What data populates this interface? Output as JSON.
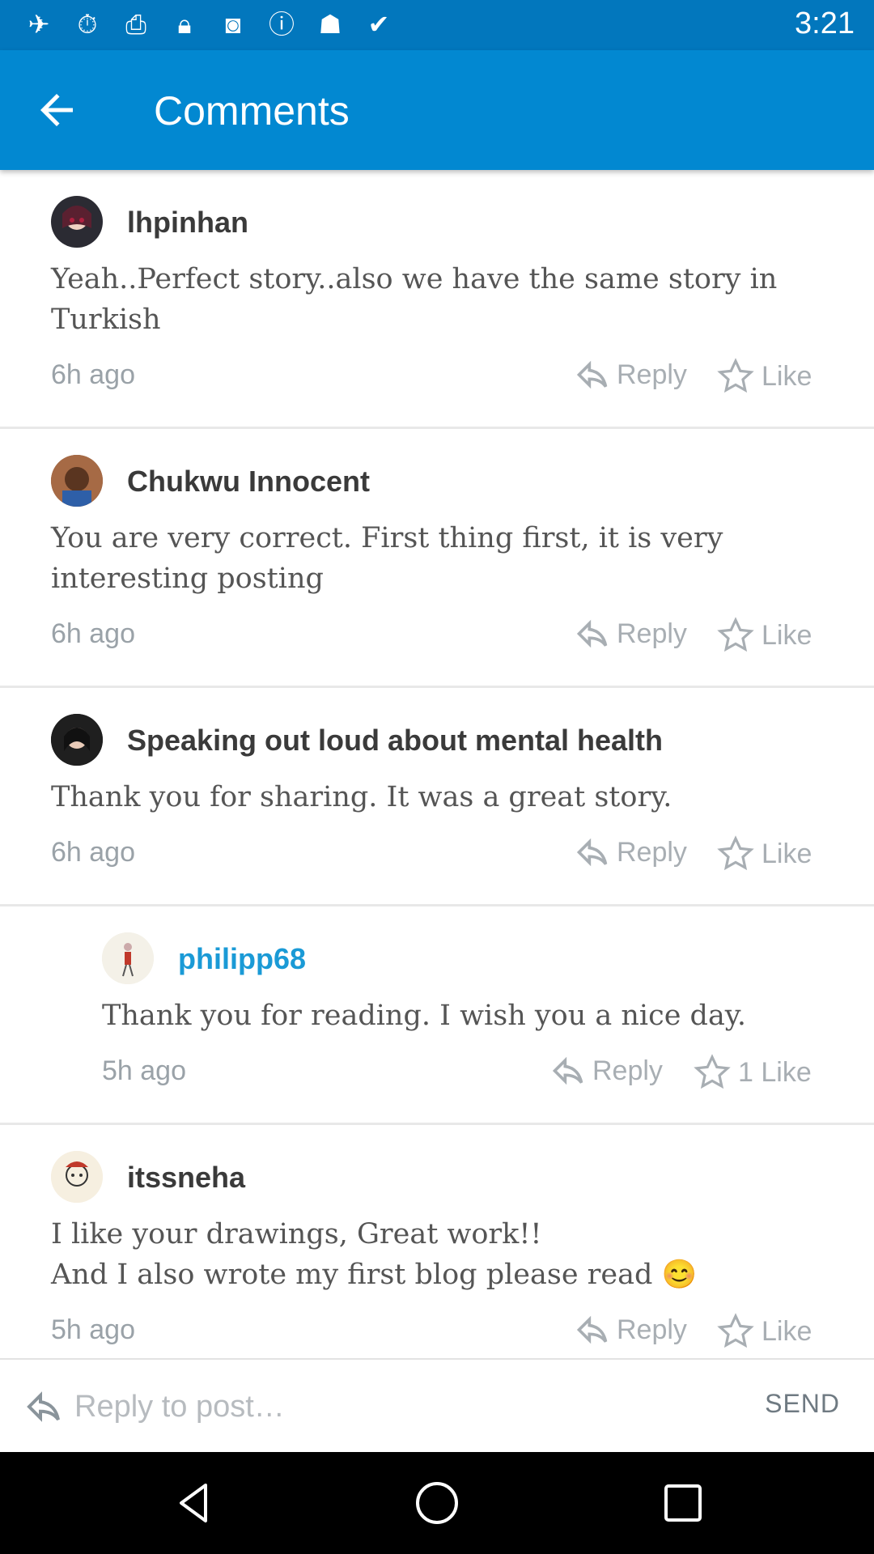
{
  "status_bar": {
    "time": "3:21",
    "icons": [
      "airplane-icon",
      "stopwatch-icon",
      "printer-icon",
      "lock-icon",
      "instagram-icon",
      "info-icon",
      "cat-icon",
      "briefcase-check-icon"
    ]
  },
  "app_bar": {
    "title": "Comments",
    "background": "#0288d1"
  },
  "comments": [
    {
      "username": "lhpinhan",
      "text": "Yeah..Perfect story..also we have the same story in Turkish",
      "time": "6h ago",
      "reply_label": "Reply",
      "like_label": "Like"
    },
    {
      "username": "Chukwu Innocent",
      "text": "You are very correct. First thing first, it is very interesting posting",
      "time": "6h ago",
      "reply_label": "Reply",
      "like_label": "Like"
    },
    {
      "username": "Speaking out loud about mental health",
      "text": "Thank you for sharing. It was a great story.",
      "time": "6h ago",
      "reply_label": "Reply",
      "like_label": "Like"
    },
    {
      "username": "philipp68",
      "text": "Thank you for reading. I wish you a nice day.",
      "time": "5h ago",
      "reply_label": "Reply",
      "like_label": "1 Like"
    },
    {
      "username": "itssneha",
      "text": "I like your drawings, Great work!!\nAnd I also wrote my first blog please read 😊",
      "time": "5h ago",
      "reply_label": "Reply",
      "like_label": "Like"
    }
  ],
  "reply_bar": {
    "placeholder": "Reply to post…",
    "value": "",
    "send_label": "SEND"
  },
  "colors": {
    "accent": "#0288d1",
    "author_name": "#1a9ad6",
    "muted": "#a8aeb3"
  }
}
